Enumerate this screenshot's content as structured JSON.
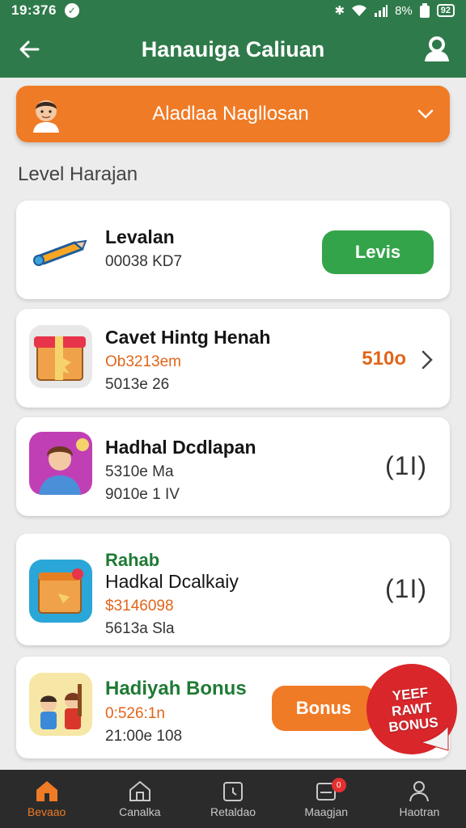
{
  "status_bar": {
    "time": "19:376",
    "battery_text": "8%",
    "battery_icon_text": "92"
  },
  "app_bar": {
    "title": "Hanauiga Caliuan"
  },
  "selector": {
    "label": "Aladlaa Nagllosan"
  },
  "section": {
    "title": "Level Harajan"
  },
  "cards": [
    {
      "name": "Levalan",
      "line1": "00038 KD7",
      "button": "Levis"
    },
    {
      "name": "Cavet Hintg Henah",
      "line1": "Ob3213em",
      "line2": "5013e 26",
      "value": "510o"
    },
    {
      "name": "Hadhal Dcdlapan",
      "line1": "5310e Ma",
      "line2": "9010e 1 IV",
      "counter": "(1I)"
    },
    {
      "tag": "Rahab",
      "name": "Hadkal Dcalkaiy",
      "line1": "$3146098",
      "line2": "5613a Sla",
      "counter": "(1I)"
    },
    {
      "name": "Hadiyah Bonus",
      "line1": "0:526:1n",
      "line2": "21:00e 108",
      "button": "Bonus",
      "ribbon": [
        "YEEF",
        "RAWT",
        "BONUS"
      ]
    }
  ],
  "bottom_nav": [
    {
      "label": "Bevaao",
      "active": true
    },
    {
      "label": "Canalka"
    },
    {
      "label": "Retaldao"
    },
    {
      "label": "Maagjan",
      "badge": "0"
    },
    {
      "label": "Haotran"
    }
  ],
  "colors": {
    "primary_green": "#2f7a4a",
    "accent_orange": "#f07b26",
    "button_green": "#34a44a",
    "ribbon_red": "#d8262b"
  },
  "icons": [
    "back-arrow-icon",
    "profile-icon",
    "chevron-down-icon",
    "chevron-right-icon",
    "home-icon",
    "building-icon",
    "calendar-icon",
    "inbox-icon",
    "user-icon"
  ]
}
